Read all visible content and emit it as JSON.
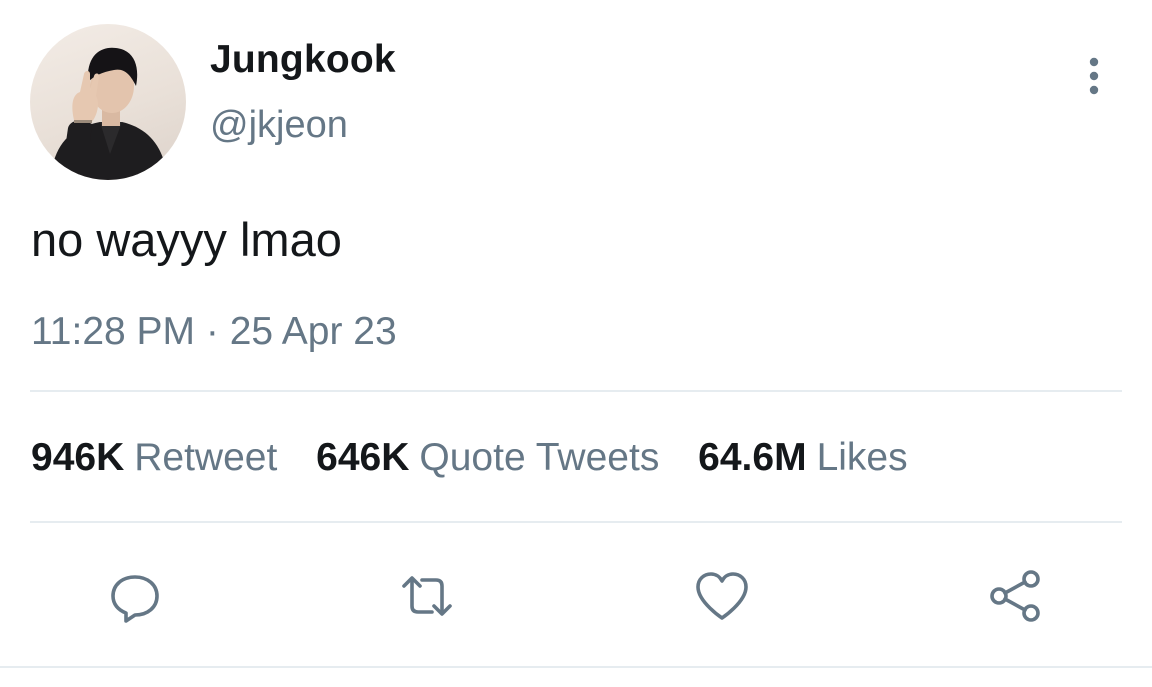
{
  "tweet": {
    "author": {
      "name": "Jungkook",
      "handle": "@jkjeon",
      "avatar_icon": "profile-photo"
    },
    "text": "no wayyy lmao",
    "timestamp": "11:28 PM · 25 Apr 23",
    "stats": [
      {
        "count": "946K",
        "label": "Retweet"
      },
      {
        "count": "646K",
        "label": "Quote Tweets"
      },
      {
        "count": "64.6M",
        "label": "Likes"
      }
    ],
    "actions": [
      {
        "icon": "reply-icon"
      },
      {
        "icon": "retweet-icon"
      },
      {
        "icon": "heart-icon"
      },
      {
        "icon": "share-icon"
      }
    ],
    "menu_icon": "more-vertical-icon"
  },
  "colors": {
    "text_primary": "#14171a",
    "text_secondary": "#657786",
    "divider": "#e6ecf0",
    "background": "#ffffff"
  }
}
